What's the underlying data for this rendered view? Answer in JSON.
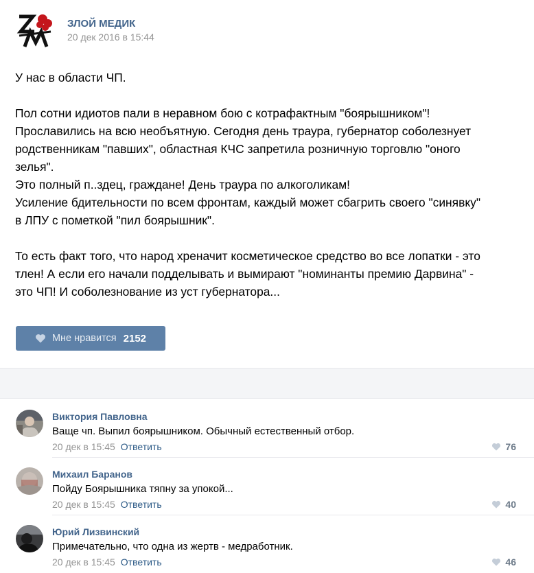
{
  "post": {
    "author": "ЗЛОЙ МЕДИК",
    "date": "20 дек 2016 в 15:44",
    "avatar_icon": "zm-logo-icon",
    "paragraphs": [
      "У нас в области ЧП.",
      "Пол сотни идиотов пали в неравном бою с котрафактным \"боярышником\"!\nПрославились на всю необъятную. Сегодня день траура, губернатор соболезнует\nродственникам \"павших\", областная КЧС запретила розничную торговлю \"оного\nзелья\".\nЭто полный п..здец, граждане! День траура по алкоголикам!\nУсиление бдительности по всем фронтам, каждый может сбагрить своего \"синявку\"\nв ЛПУ с пометкой \"пил боярышник\".",
      "То есть факт того, что народ хреначит косметическое средство во все лопатки - это\nтлен! А если его начали подделывать и вымирают \"номинанты премию Дарвина\" -\nэто ЧП! И соболезнование из уст губернатора..."
    ],
    "like_label": "Мне нравится",
    "like_count": "2152"
  },
  "comments": [
    {
      "name": "Виктория Павловна",
      "text": "Ваще чп. Выпил боярышником. Обычный естественный отбор.",
      "date": "20 дек в 15:45",
      "reply_label": "Ответить",
      "likes": "76"
    },
    {
      "name": "Михаил Баранов",
      "text": "Пойду Боярышника тяпну за упокой...",
      "date": "20 дек в 15:45",
      "reply_label": "Ответить",
      "likes": "40"
    },
    {
      "name": "Юрий Лизвинский",
      "text": "Примечательно, что одна из жертв - медработник.",
      "date": "20 дек в 15:45",
      "reply_label": "Ответить",
      "likes": "46"
    }
  ],
  "colors": {
    "link": "#42648b",
    "like_button": "#5e81a8",
    "meta_gray": "#939393"
  }
}
